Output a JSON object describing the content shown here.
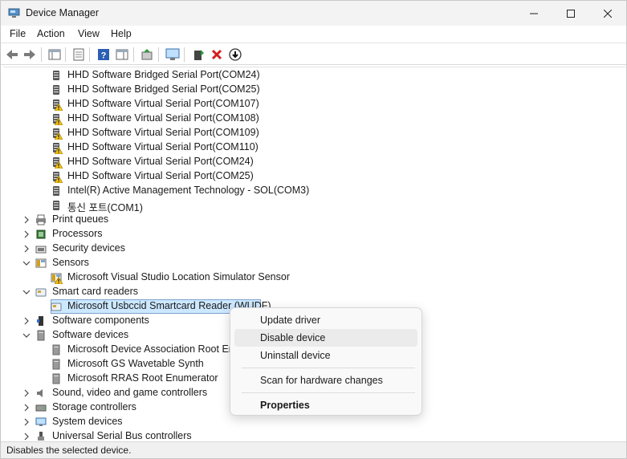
{
  "window": {
    "title": "Device Manager"
  },
  "menubar": {
    "items": [
      "File",
      "Action",
      "View",
      "Help"
    ]
  },
  "toolbar": {
    "buttons": [
      "back-icon",
      "forward-icon",
      "console-tree-icon",
      "properties-icon",
      "help-icon",
      "action-pane-icon",
      "update-driver-icon",
      "scan-hardware-icon",
      "add-legacy-icon",
      "uninstall-icon",
      "disable-icon"
    ]
  },
  "tree": {
    "rows": [
      {
        "label": "HHD Software Bridged Serial Port(COM24)",
        "level": 2,
        "icon": "port-icon",
        "warning": false
      },
      {
        "label": "HHD Software Bridged Serial Port(COM25)",
        "level": 2,
        "icon": "port-icon",
        "warning": false
      },
      {
        "label": "HHD Software Virtual Serial Port(COM107)",
        "level": 2,
        "icon": "port-icon",
        "warning": true
      },
      {
        "label": "HHD Software Virtual Serial Port(COM108)",
        "level": 2,
        "icon": "port-icon",
        "warning": true
      },
      {
        "label": "HHD Software Virtual Serial Port(COM109)",
        "level": 2,
        "icon": "port-icon",
        "warning": true
      },
      {
        "label": "HHD Software Virtual Serial Port(COM110)",
        "level": 2,
        "icon": "port-icon",
        "warning": true
      },
      {
        "label": "HHD Software Virtual Serial Port(COM24)",
        "level": 2,
        "icon": "port-icon",
        "warning": true
      },
      {
        "label": "HHD Software Virtual Serial Port(COM25)",
        "level": 2,
        "icon": "port-icon",
        "warning": true
      },
      {
        "label": "Intel(R) Active Management Technology - SOL(COM3)",
        "level": 2,
        "icon": "port-icon",
        "warning": false
      },
      {
        "label": "통신 포트(COM1)",
        "level": 2,
        "icon": "port-icon",
        "warning": false
      },
      {
        "label": "Print queues",
        "level": 1,
        "icon": "printer-icon",
        "expander": "collapsed"
      },
      {
        "label": "Processors",
        "level": 1,
        "icon": "processor-icon",
        "expander": "collapsed"
      },
      {
        "label": "Security devices",
        "level": 1,
        "icon": "security-icon",
        "expander": "collapsed"
      },
      {
        "label": "Sensors",
        "level": 1,
        "icon": "sensor-icon",
        "expander": "expanded"
      },
      {
        "label": "Microsoft Visual Studio Location Simulator Sensor",
        "level": 2,
        "icon": "sensor-icon",
        "warning": true
      },
      {
        "label": "Smart card readers",
        "level": 1,
        "icon": "smartcard-icon",
        "expander": "expanded"
      },
      {
        "label": "Microsoft Usbccid Smartcard Reader (WUDF)",
        "level": 2,
        "icon": "smartcard-icon",
        "warning": false,
        "selected": true
      },
      {
        "label": "Software components",
        "level": 1,
        "icon": "component-icon",
        "expander": "collapsed"
      },
      {
        "label": "Software devices",
        "level": 1,
        "icon": "software-device-icon",
        "expander": "expanded"
      },
      {
        "label": "Microsoft Device Association Root Enu",
        "level": 2,
        "icon": "software-device-icon",
        "warning": false
      },
      {
        "label": "Microsoft GS Wavetable Synth",
        "level": 2,
        "icon": "software-device-icon",
        "warning": false
      },
      {
        "label": "Microsoft RRAS Root Enumerator",
        "level": 2,
        "icon": "software-device-icon",
        "warning": false
      },
      {
        "label": "Sound, video and game controllers",
        "level": 1,
        "icon": "speaker-icon",
        "expander": "collapsed"
      },
      {
        "label": "Storage controllers",
        "level": 1,
        "icon": "storage-icon",
        "expander": "collapsed"
      },
      {
        "label": "System devices",
        "level": 1,
        "icon": "system-icon",
        "expander": "collapsed"
      },
      {
        "label": "Universal Serial Bus controllers",
        "level": 1,
        "icon": "usb-icon",
        "expander": "collapsed"
      }
    ]
  },
  "context_menu": {
    "items": [
      {
        "label": "Update driver",
        "bold": false
      },
      {
        "label": "Disable device",
        "bold": false,
        "hover": true
      },
      {
        "label": "Uninstall device",
        "bold": false
      },
      {
        "label": "Scan for hardware changes",
        "bold": false
      },
      {
        "label": "Properties",
        "bold": true
      }
    ]
  },
  "statusbar": {
    "text": "Disables the selected device."
  }
}
